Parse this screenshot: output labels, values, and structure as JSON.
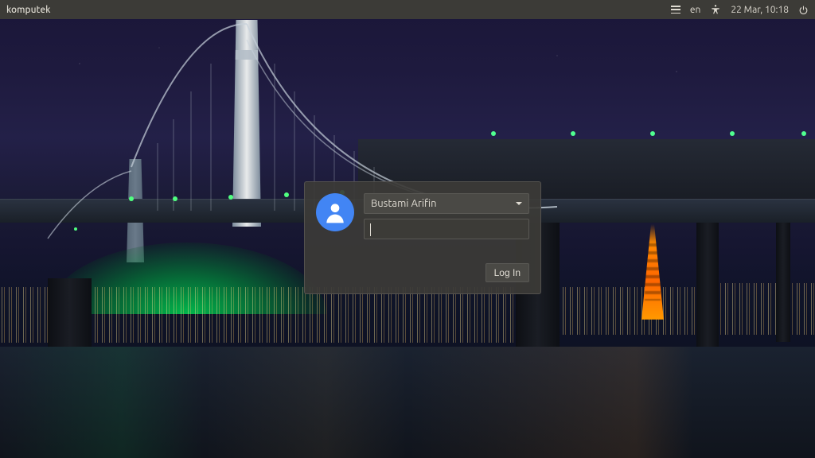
{
  "panel": {
    "hostname": "komputek",
    "language": "en",
    "datetime": "22 Mar, 10:18"
  },
  "login": {
    "username": "Bustami Arifin",
    "password_value": "",
    "login_button": "Log In"
  }
}
